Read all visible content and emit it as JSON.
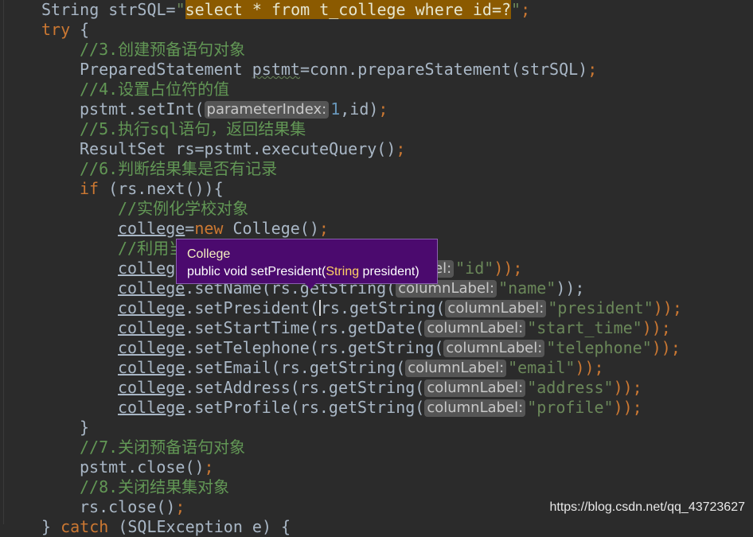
{
  "editor": {
    "lines": [
      {
        "code_a": "String strSQL=",
        "str_q1": "\"",
        "sql": "select * from t_college where id=?",
        "str_q2": "\"",
        "end": ";"
      },
      {
        "kw": "try",
        "rest": " {"
      },
      {
        "comment": "//3.创建预备语句对象"
      },
      {
        "a": "PreparedStatement ",
        "var": "pstmt",
        "b": "=conn.prepareStatement(strSQL)",
        "end": ";"
      },
      {
        "comment": "//4.设置占位符的值"
      },
      {
        "a": "pstmt.setInt(",
        "hint": "parameterIndex:",
        "num": "1",
        "b": ",id)",
        "end": ";"
      },
      {
        "comment": "//5.执行sql语句，返回结果集"
      },
      {
        "a": "ResultSet rs=pstmt.executeQuery()",
        "end": ";"
      },
      {
        "comment": "//6.判断结果集是否有记录"
      },
      {
        "kw": "if",
        "rest": " (rs.next()){"
      },
      {
        "comment": "//实例化学校对象"
      },
      {
        "fld": "college",
        "eq": "=",
        "kw": "new",
        "rest": " College()",
        "end": ";"
      },
      {
        "comment": "//利用当"
      },
      {
        "fld": "colleg",
        "tail_hint": "el:",
        "str": "\"id\"",
        "end": "));"
      },
      {
        "fld": "college",
        "a": ".setName(rs.getString(",
        "hint": "columnLabel:",
        "str": "\"name\"",
        "end": "));"
      },
      {
        "fld": "college",
        "a": ".setPresident(",
        "b": "rs.getString(",
        "hint": "columnLabel:",
        "str": "\"president\"",
        "end": "));"
      },
      {
        "fld": "college",
        "a": ".setStartTime(rs.getDate(",
        "hint": "columnLabel:",
        "str": "\"start_time\"",
        "end": "));"
      },
      {
        "fld": "college",
        "a": ".setTelephone(rs.getString(",
        "hint": "columnLabel:",
        "str": "\"telephone\"",
        "end": "));"
      },
      {
        "fld": "college",
        "a": ".setEmail(rs.getString(",
        "hint": "columnLabel:",
        "str": "\"email\"",
        "end": "));"
      },
      {
        "fld": "college",
        "a": ".setAddress(rs.getString(",
        "hint": "columnLabel:",
        "str": "\"address\"",
        "end": "));"
      },
      {
        "fld": "college",
        "a": ".setProfile(rs.getString(",
        "hint": "columnLabel:",
        "str": "\"profile\"",
        "end": "));"
      },
      {
        "rest": "}"
      },
      {
        "comment": "//7.关闭预备语句对象"
      },
      {
        "a": "pstmt.close()",
        "end": ";"
      },
      {
        "comment": "//8.关闭结果集对象"
      },
      {
        "a": "rs.close()",
        "end": ";"
      },
      {
        "a": "} ",
        "kw": "catch",
        "rest": " (SQLException e) {"
      }
    ]
  },
  "tooltip": {
    "class_name": "College",
    "sig_prefix": "public void setPresident(",
    "param_type": "String",
    "sig_suffix": " president)"
  },
  "watermark": "https://blog.csdn.net/qq_43723627"
}
